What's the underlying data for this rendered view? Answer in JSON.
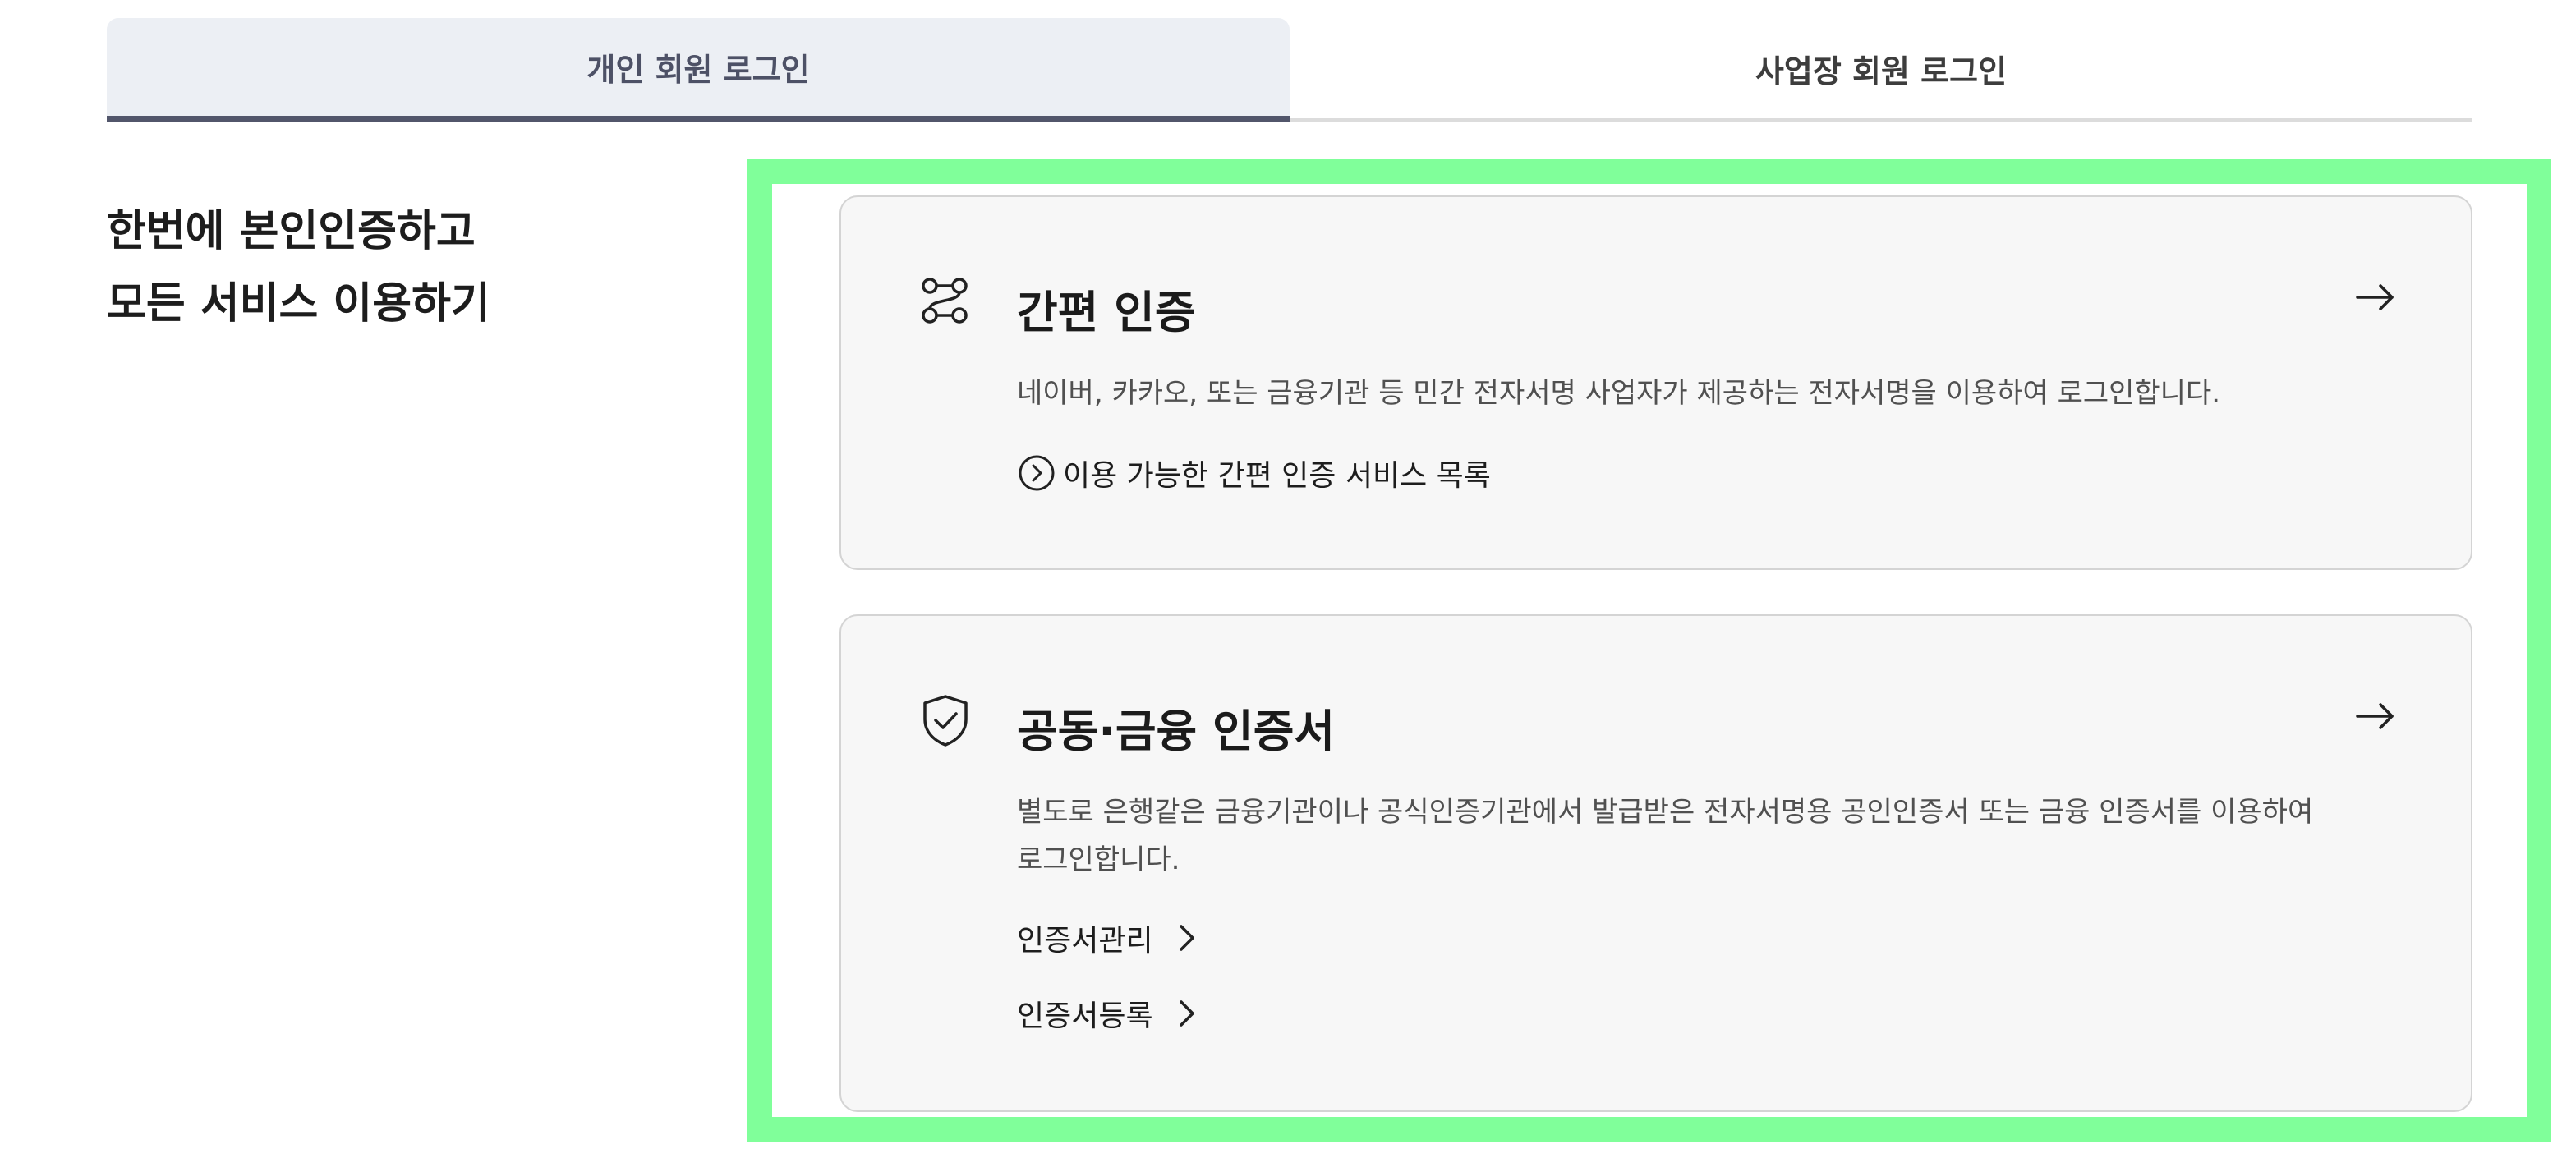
{
  "tabs": [
    {
      "label": "개인 회원 로그인",
      "active": true
    },
    {
      "label": "사업장 회원 로그인",
      "active": false
    }
  ],
  "headline": {
    "line1": "한번에 본인인증하고",
    "line2": "모든 서비스 이용하기"
  },
  "cards": [
    {
      "title": "간편 인증",
      "icon": "flow-nodes-icon",
      "description": "네이버, 카카오, 또는 금융기관 등 민간 전자서명 사업자가 제공하는 전자서명을 이용하여 로그인합니다.",
      "link_label": "이용 가능한 간편 인증 서비스 목록",
      "arrow": "→"
    },
    {
      "title": "공동·금융 인증서",
      "icon": "shield-check-icon",
      "description": "별도로 은행같은 금융기관이나 공식인증기관에서 발급받은 전자서명용 공인인증서 또는 금융 인증서를 이용하여 로그인합니다.",
      "links": [
        "인증서관리",
        "인증서등록"
      ],
      "arrow": "→"
    }
  ],
  "colors": {
    "active_tab_bg": "#eceff4",
    "active_tab_border": "#52566b",
    "highlight_frame": "#80ff9a",
    "card_bg": "#f7f7f7"
  }
}
